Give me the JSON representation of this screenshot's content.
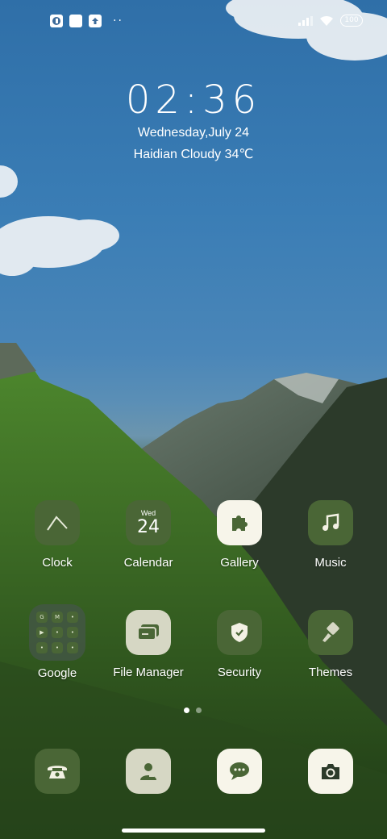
{
  "status": {
    "left_icons": [
      "app-notification-icon",
      "square-notification-icon",
      "upload-notification-icon"
    ],
    "right_icons": [
      "signal-icon",
      "wifi-icon"
    ],
    "battery": "100"
  },
  "lockscreen": {
    "time": "02:36",
    "date": "Wednesday,July 24",
    "weather": "Haidian Cloudy 34℃"
  },
  "apps_row1": [
    {
      "label": "Clock"
    },
    {
      "label": "Calendar",
      "day": "Wed",
      "num": "24"
    },
    {
      "label": "Gallery"
    },
    {
      "label": "Music"
    }
  ],
  "apps_row2": [
    {
      "label": "Google",
      "folder_letters": [
        "G",
        "M",
        "•",
        "▶",
        "•",
        "•",
        "•",
        "•",
        "•"
      ]
    },
    {
      "label": "File Manager"
    },
    {
      "label": "Security"
    },
    {
      "label": "Themes"
    }
  ],
  "dock": [
    {
      "name": "phone"
    },
    {
      "name": "contacts"
    },
    {
      "name": "messages"
    },
    {
      "name": "camera"
    }
  ],
  "pager": {
    "pages": 2,
    "active": 1
  },
  "colors": {
    "icon_dark": "#4a6636",
    "icon_light": "#f7f5ea",
    "icon_beige": "#d6d7c4"
  }
}
